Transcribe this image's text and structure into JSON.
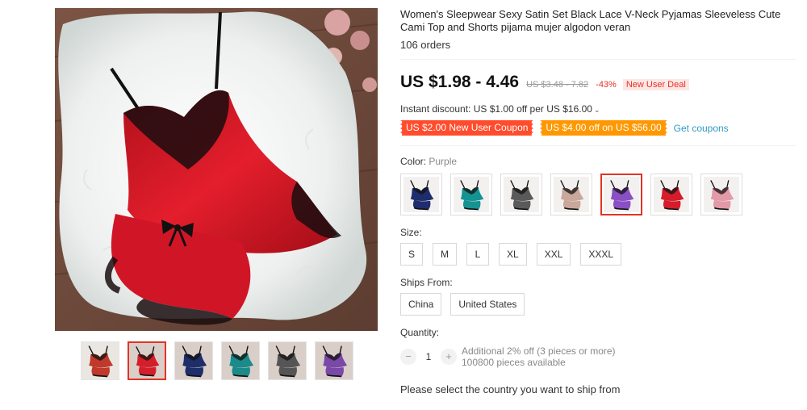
{
  "product": {
    "title": "Women's Sleepwear Sexy Satin Set Black Lace V-Neck Pyjamas Sleeveless Cute Cami Top and Shorts pijama mujer algodon veran",
    "orders": "106 orders",
    "main_image_icon": "red-satin-cami-set-photo"
  },
  "gallery": {
    "thumbnails": [
      {
        "name": "multi-color-collage",
        "color": "#c0392b"
      },
      {
        "name": "red",
        "color": "#d41f2b"
      },
      {
        "name": "navy",
        "color": "#1e2e6b"
      },
      {
        "name": "teal",
        "color": "#1a8a8a"
      },
      {
        "name": "black-lace",
        "color": "#555555"
      },
      {
        "name": "purple",
        "color": "#7a48a8"
      }
    ],
    "active_index": 1
  },
  "pricing": {
    "price": "US $1.98 - 4.46",
    "original_price": "US $3.48 - 7.82",
    "discount": "-43%",
    "deal_badge": "New User Deal",
    "instant_discount": "Instant discount: US $1.00 off per US $16.00",
    "coupons": [
      {
        "label": "US $2.00 New User Coupon",
        "style": "red"
      },
      {
        "label": "US $4.00 off on US $56.00",
        "style": "orange"
      }
    ],
    "get_coupons": "Get coupons"
  },
  "color": {
    "label": "Color:",
    "selected": "Purple",
    "swatches": [
      {
        "name": "navy",
        "color": "#1f2d6e"
      },
      {
        "name": "teal",
        "color": "#159392"
      },
      {
        "name": "black-lace",
        "color": "#5a5a5a"
      },
      {
        "name": "champagne",
        "color": "#c9a79a"
      },
      {
        "name": "purple",
        "color": "#8a4fc4"
      },
      {
        "name": "red",
        "color": "#d61c2a"
      },
      {
        "name": "pink",
        "color": "#e39aa8"
      }
    ],
    "active_index": 4
  },
  "size": {
    "label": "Size:",
    "options": [
      "S",
      "M",
      "L",
      "XL",
      "XXL",
      "XXXL"
    ]
  },
  "ships_from": {
    "label": "Ships From:",
    "options": [
      "China",
      "United States"
    ]
  },
  "quantity": {
    "label": "Quantity:",
    "minus": "−",
    "value": "1",
    "plus": "+",
    "note_line1": "Additional 2% off (3 pieces or more)",
    "note_line2": "100800 pieces available"
  },
  "shipping_prompt": "Please select the country you want to ship from",
  "colors": {
    "accent": "#e43225",
    "coupon_red": "#ff4c2d",
    "coupon_orange": "#ff9800",
    "link": "#2e9cc3"
  }
}
